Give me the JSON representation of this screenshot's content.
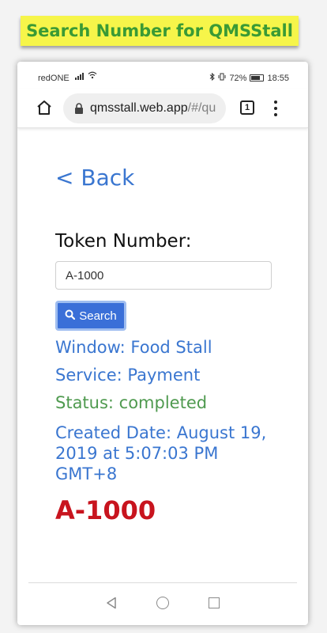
{
  "banner": {
    "title": "Search Number for QMSStall"
  },
  "status_bar": {
    "carrier": "redONE",
    "battery_pct": "72%",
    "time": "18:55"
  },
  "browser": {
    "url_host": "qmsstall.web.app",
    "url_rest": "/#/qu",
    "tab_count": "1"
  },
  "page": {
    "back_label": "< Back",
    "token_label": "Token Number:",
    "token_value": "A-1000",
    "search_label": "Search",
    "window_text": "Window: Food Stall",
    "service_text": "Service: Payment",
    "status_text": "Status: completed",
    "created_text": "Created Date: August 19, 2019 at 5:07:03 PM GMT+8",
    "big_token": "A-1000"
  },
  "colors": {
    "banner_bg": "#f6f54a",
    "banner_text": "#3a9a35",
    "link_blue": "#3a76d0",
    "status_green": "#4f9a4f",
    "token_red": "#c8141e",
    "button_blue": "#3a6fd8"
  },
  "icons": {
    "home": "home-icon",
    "lock": "lock-icon",
    "search": "search-icon",
    "menu": "more-vert-icon",
    "nav_back": "triangle-back-icon",
    "nav_home": "circle-home-icon",
    "nav_recent": "square-recent-icon"
  }
}
